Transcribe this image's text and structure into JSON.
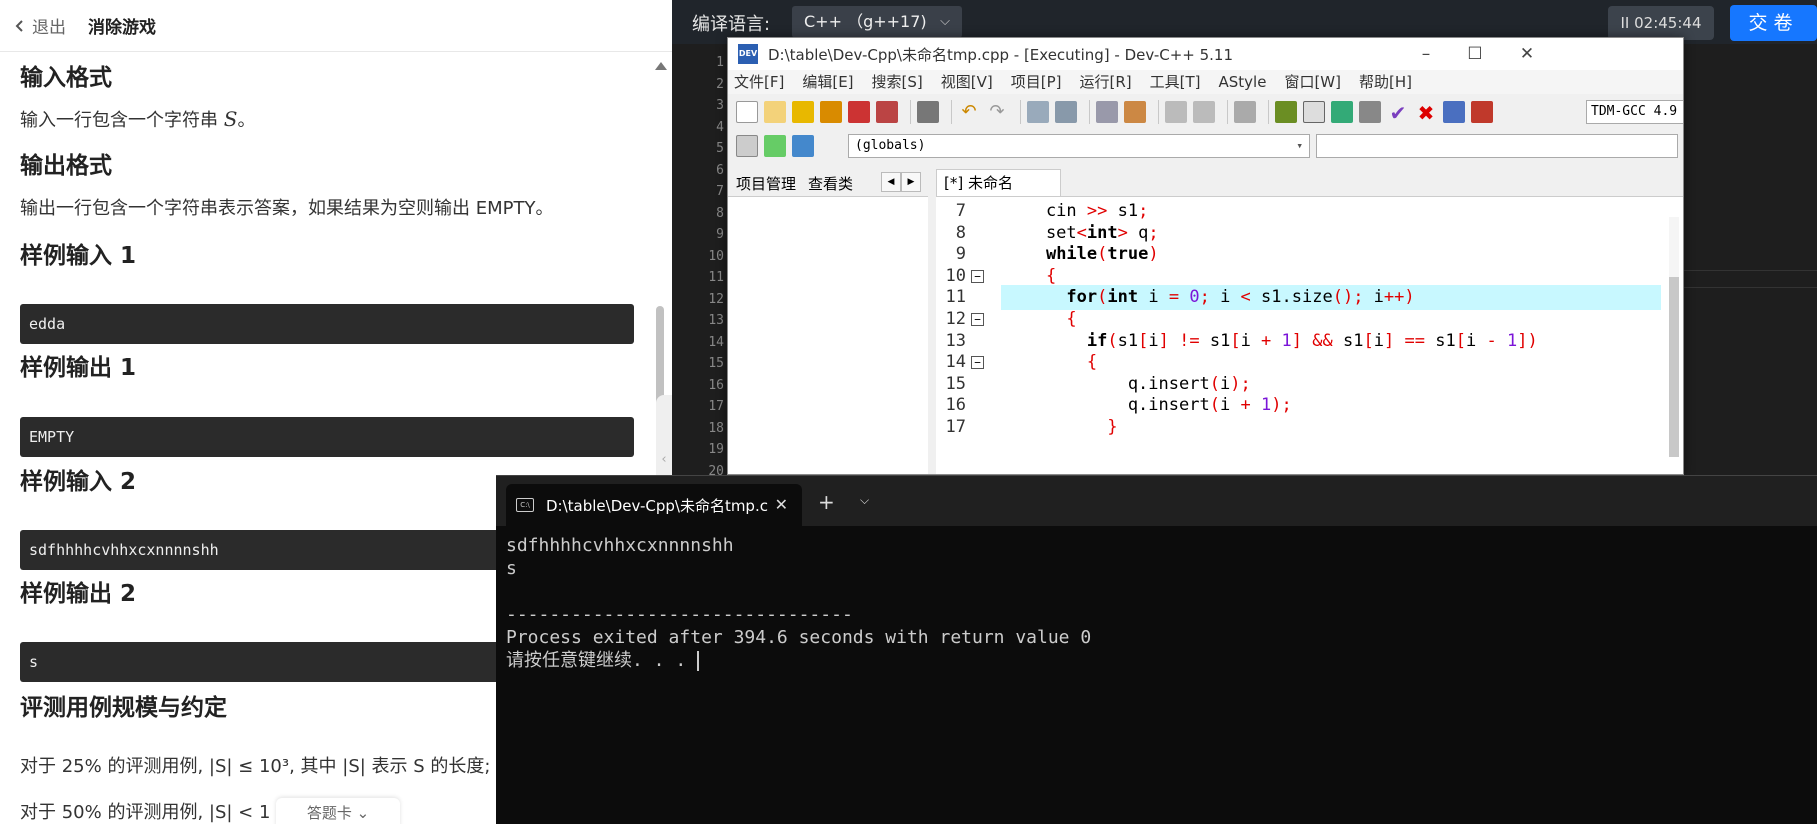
{
  "left_panel": {
    "back_label": "退出",
    "game_name": "消除游戏",
    "sections": [
      {
        "heading": "输入格式",
        "text_before": "输入一行包含一个字符串 ",
        "var": "S",
        "text_after": "。"
      },
      {
        "heading": "输出格式",
        "text": "输出一行包含一个字符串表示答案，如果结果为空则输出 EMPTY。"
      },
      {
        "heading": "样例输入 1",
        "code": "edda"
      },
      {
        "heading": "样例输出 1",
        "code": "EMPTY"
      },
      {
        "heading": "样例输入 2",
        "code": "sdfhhhhcvhhxcxnnnnshh"
      },
      {
        "heading": "样例输出 2",
        "code": "s"
      },
      {
        "heading": "评测用例规模与约定"
      }
    ],
    "constraint_1": "对于 25% 的评测用例, |S| ≤ 10³, 其中 |S| 表示 S 的长度;",
    "constraint_2": "对于 50% 的评测用例, |S| < 1",
    "answer_card_label": "答题卡"
  },
  "topbar": {
    "lang_label": "编译语言:",
    "lang_value": "C++ （g++17)",
    "timer": "02:45:44",
    "submit_label": "交卷"
  },
  "editor_line_numbers": [
    "1",
    "2",
    "3",
    "4",
    "5",
    "6",
    "7",
    "8",
    "9",
    "10",
    "11",
    "12",
    "13",
    "14",
    "15",
    "16",
    "17",
    "18",
    "19",
    "20"
  ],
  "devcpp": {
    "title": "D:\\table\\Dev-Cpp\\未命名tmp.cpp - [Executing] - Dev-C++ 5.11",
    "logo": "DEV",
    "menu": [
      "文件[F]",
      "编辑[E]",
      "搜索[S]",
      "视图[V]",
      "项目[P]",
      "运行[R]",
      "工具[T]",
      "AStyle",
      "窗口[W]",
      "帮助[H]"
    ],
    "compiler": "TDM-GCC 4.9",
    "globals": "(globals)",
    "tab_project": "项目管理",
    "tab_classes": "查看类",
    "file_tab": "[*] 未命名tmp.cpp",
    "code_lines": [
      {
        "n": "7",
        "text": "    cin >> s1;"
      },
      {
        "n": "8",
        "text": "    set<int> q;"
      },
      {
        "n": "9",
        "text": "    while(true)"
      },
      {
        "n": "10",
        "text": "    {"
      },
      {
        "n": "11",
        "text": "      for(int i = 0; i < s1.size(); i++)"
      },
      {
        "n": "12",
        "text": "      {"
      },
      {
        "n": "13",
        "text": "        if(s1[i] != s1[i + 1] && s1[i] == s1[i - 1])"
      },
      {
        "n": "14",
        "text": "        {"
      },
      {
        "n": "15",
        "text": "            q.insert(i);"
      },
      {
        "n": "16",
        "text": "            q.insert(i + 1);"
      },
      {
        "n": "17",
        "text": "          }"
      }
    ]
  },
  "terminal": {
    "tab_title": "D:\\table\\Dev-Cpp\\未命名tmp.c",
    "tab_icon": "C:\\",
    "lines": [
      "sdfhhhhcvhhxcxnnnnshh",
      "s",
      "",
      "--------------------------------",
      "Process exited after 394.6 seconds with return value 0",
      "请按任意键继续. . . "
    ]
  },
  "colors": {
    "accent": "#1677ff",
    "dark_header": "#20252b",
    "terminal_bg": "#0c0c0c",
    "highlight_line": "#c8f8ff"
  }
}
